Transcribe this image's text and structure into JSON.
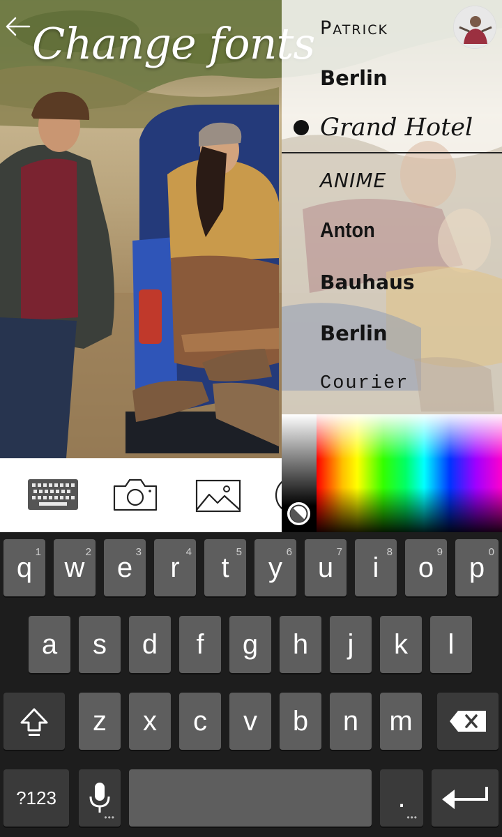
{
  "header": {
    "title": "Change fonts",
    "back_icon": "arrow-left-icon"
  },
  "font_list": {
    "selected": "Grand Hotel",
    "items": [
      {
        "label": "Patrick",
        "style": "patrick"
      },
      {
        "label": "Berlin",
        "style": "berlin"
      },
      {
        "label": "Grand Hotel",
        "style": "grand"
      },
      {
        "label": "ANIME",
        "style": "anime"
      },
      {
        "label": "Anton",
        "style": "anton"
      },
      {
        "label": "Bauhaus",
        "style": "bauhaus"
      },
      {
        "label": "Berlin",
        "style": "berlin"
      },
      {
        "label": "Courier",
        "style": "courier"
      }
    ]
  },
  "toolbar": {
    "items": [
      {
        "name": "keyboard-icon"
      },
      {
        "name": "camera-icon"
      },
      {
        "name": "image-icon"
      },
      {
        "name": "color-wheel-icon"
      }
    ]
  },
  "color_picker": {
    "marker_icon": "color-wheel-icon"
  },
  "keyboard": {
    "row1": [
      {
        "label": "q",
        "hint": "1"
      },
      {
        "label": "w",
        "hint": "2"
      },
      {
        "label": "e",
        "hint": "3"
      },
      {
        "label": "r",
        "hint": "4"
      },
      {
        "label": "t",
        "hint": "5"
      },
      {
        "label": "y",
        "hint": "6"
      },
      {
        "label": "u",
        "hint": "7"
      },
      {
        "label": "i",
        "hint": "8"
      },
      {
        "label": "o",
        "hint": "9"
      },
      {
        "label": "p",
        "hint": "0"
      }
    ],
    "row2": [
      "a",
      "s",
      "d",
      "f",
      "g",
      "h",
      "j",
      "k",
      "l"
    ],
    "row3": [
      "z",
      "x",
      "c",
      "v",
      "b",
      "n",
      "m"
    ],
    "symbols_label": "?123",
    "period_label": ".",
    "shift_icon": "shift-icon",
    "backspace_icon": "backspace-icon",
    "mic_icon": "microphone-icon",
    "enter_icon": "enter-arrow-icon",
    "colors": {
      "key": "#5e5e5e",
      "key_dark": "#3a3a3a",
      "background": "#1d1d1d"
    }
  }
}
